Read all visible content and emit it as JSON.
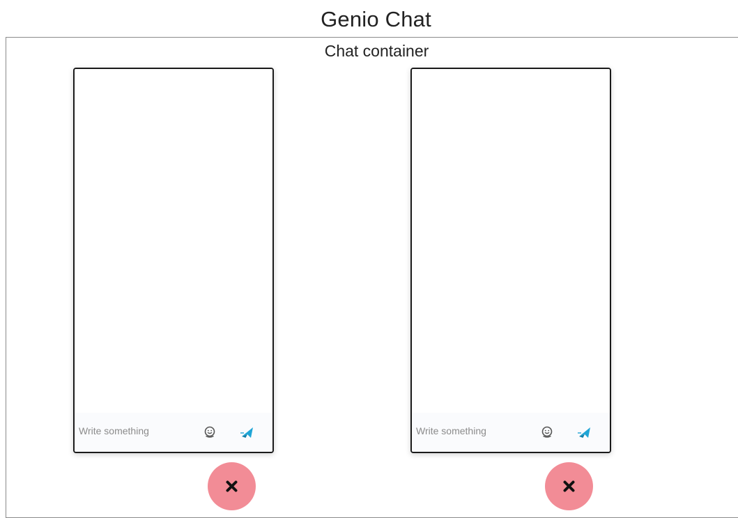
{
  "app": {
    "title": "Genio Chat"
  },
  "container": {
    "title": "Chat container"
  },
  "chat_windows": [
    {
      "input": {
        "placeholder": "Write something",
        "value": ""
      },
      "icons": {
        "emoji": "emoji-smile-icon",
        "send": "paper-plane-send-icon",
        "close": "close-x-icon"
      }
    },
    {
      "input": {
        "placeholder": "Write something",
        "value": ""
      },
      "icons": {
        "emoji": "emoji-smile-icon",
        "send": "paper-plane-send-icon",
        "close": "close-x-icon"
      }
    }
  ],
  "colors": {
    "send_icon": "#1fa5d6",
    "close_button": "#f28c96",
    "divider": "#c0392b"
  }
}
